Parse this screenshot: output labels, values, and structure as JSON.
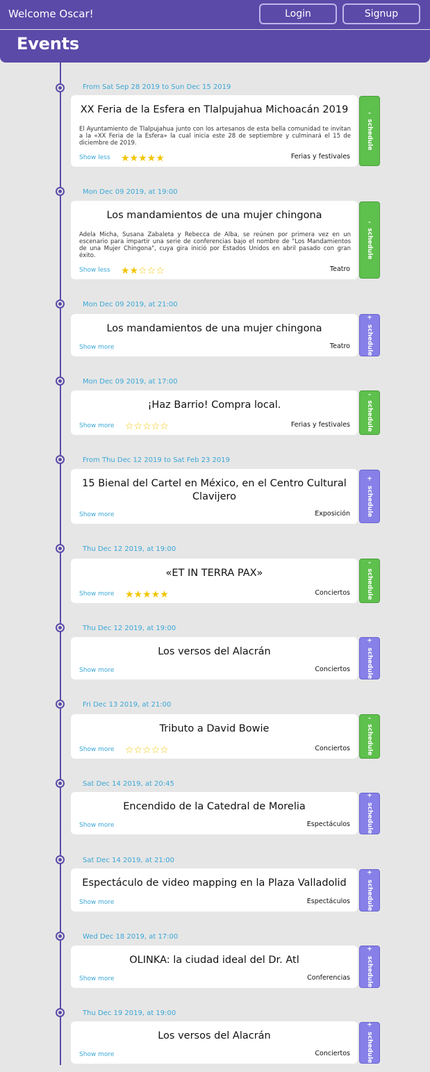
{
  "header": {
    "welcome": "Welcome Oscar!",
    "login_label": "Login",
    "signup_label": "Signup",
    "section_title": "Events"
  },
  "colors": {
    "brand": "#5b4aa8",
    "date": "#3aa7d6",
    "schedule_added": "#5ec04d",
    "schedule_add": "#8680e8",
    "star": "#f2c500"
  },
  "events": [
    {
      "date": "From Sat Sep 28 2019 to Sun Dec 15 2019",
      "title": "XX Feria de la Esfera en Tlalpujahua Michoacán 2019",
      "description": "El Ayuntamiento de Tlalpujahua junto con los artesanos de esta bella comunidad te invitan a la «XX Feria de la Esfera» la cual inicia este 28 de septiembre y culminará el 15 de diciembre de 2019.",
      "toggle": "Show less",
      "stars": "★★★★★",
      "category": "Ferias y festivales",
      "schedule_label": "schedule",
      "schedule_symbol": "-",
      "scheduled": true
    },
    {
      "date": "Mon Dec 09 2019, at 19:00",
      "title": "Los mandamientos de una mujer chingona",
      "description": "Adela Micha, Susana Zabaleta y Rebecca de Alba, se reúnen por primera vez en un escenario para impartir una serie de conferencias bajo el nombre de \"Los Mandamientos de una Mujer Chingona\", cuya gira inició por Estados Unidos en abril pasado con gran éxito.",
      "toggle": "Show less",
      "stars": "★★☆☆☆",
      "category": "Teatro",
      "schedule_label": "schedule",
      "schedule_symbol": "-",
      "scheduled": true
    },
    {
      "date": "Mon Dec 09 2019, at 21:00",
      "title": "Los mandamientos de una mujer chingona",
      "toggle": "Show more",
      "category": "Teatro",
      "schedule_label": "schedule",
      "schedule_symbol": "+",
      "scheduled": false
    },
    {
      "date": "Mon Dec 09 2019, at 17:00",
      "title": "¡Haz Barrio! Compra local.",
      "toggle": "Show more",
      "stars": "☆☆☆☆☆",
      "category": "Ferias y festivales",
      "schedule_label": "schedule",
      "schedule_symbol": "-",
      "scheduled": true
    },
    {
      "date": "From Thu Dec 12 2019 to Sat Feb 23 2019",
      "title": "15 Bienal del Cartel en México, en el Centro Cultural Clavijero",
      "toggle": "Show more",
      "category": "Exposición",
      "schedule_label": "schedule",
      "schedule_symbol": "+",
      "scheduled": false
    },
    {
      "date": "Thu Dec 12 2019, at 19:00",
      "title": "«ET IN TERRA PAX»",
      "toggle": "Show more",
      "stars": "★★★★★",
      "category": "Conciertos",
      "schedule_label": "schedule",
      "schedule_symbol": "-",
      "scheduled": true
    },
    {
      "date": "Thu Dec 12 2019, at 19:00",
      "title": "Los versos del Alacrán",
      "toggle": "Show more",
      "category": "Conciertos",
      "schedule_label": "schedule",
      "schedule_symbol": "+",
      "scheduled": false
    },
    {
      "date": "Fri Dec 13 2019, at 21:00",
      "title": "Tributo a David Bowie",
      "toggle": "Show more",
      "stars": "☆☆☆☆☆",
      "category": "Conciertos",
      "schedule_label": "schedule",
      "schedule_symbol": "-",
      "scheduled": true
    },
    {
      "date": "Sat Dec 14 2019, at 20:45",
      "title": "Encendido de la Catedral de Morelia",
      "toggle": "Show more",
      "category": "Espectáculos",
      "schedule_label": "schedule",
      "schedule_symbol": "+",
      "scheduled": false
    },
    {
      "date": "Sat Dec 14 2019, at 21:00",
      "title": "Espectáculo de video mapping en la Plaza Valladolid",
      "toggle": "Show more",
      "category": "Espectáculos",
      "schedule_label": "schedule",
      "schedule_symbol": "+",
      "scheduled": false
    },
    {
      "date": "Wed Dec 18 2019, at 17:00",
      "title": "OLINKA: la ciudad ideal del Dr. Atl",
      "toggle": "Show more",
      "category": "Conferencias",
      "schedule_label": "schedule",
      "schedule_symbol": "+",
      "scheduled": false
    },
    {
      "date": "Thu Dec 19 2019, at 19:00",
      "title": "Los versos del Alacrán",
      "toggle": "Show more",
      "category": "Conciertos",
      "schedule_label": "schedule",
      "schedule_symbol": "+",
      "scheduled": false
    }
  ]
}
